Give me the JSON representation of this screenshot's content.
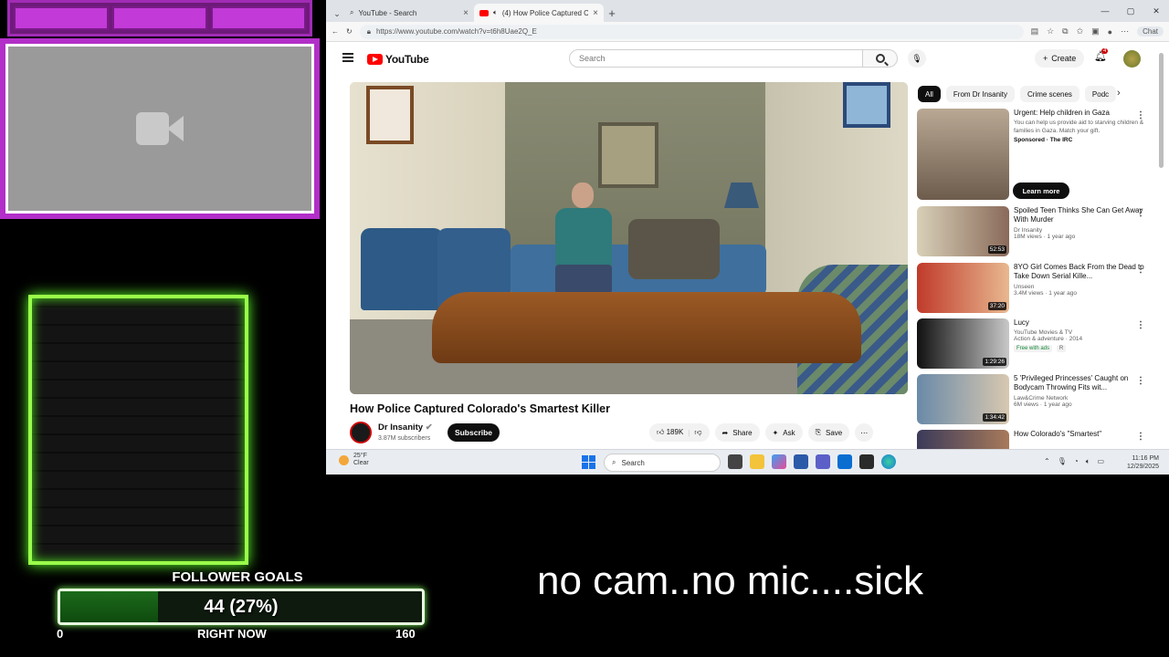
{
  "overlay": {
    "follower_goals_title": "FOLLOWER GOALS",
    "goal_current": 44,
    "goal_percent": 0.27,
    "goal_text": "44 (27%)",
    "goal_min": "0",
    "goal_now_label": "RIGHT NOW",
    "goal_max": "160",
    "caption": "no cam..no mic....sick",
    "colors": {
      "cam_frame": "#b22fc9",
      "brick_glow": "#9aff4a",
      "goal_fill": "#1c6a1c"
    }
  },
  "browser": {
    "tabs": [
      {
        "title": "YouTube - Search",
        "active": false
      },
      {
        "title": "(4) How Police Captured Colora",
        "active": true
      }
    ],
    "url": "https://www.youtube.com/watch?v=t6h8Uae2Q_E",
    "chat_label": "Chat"
  },
  "youtube": {
    "logo_text": "YouTube",
    "search_placeholder": "Search",
    "create_label": "Create",
    "notification_count": "4",
    "video": {
      "title": "How Police Captured Colorado's Smartest Killer",
      "channel": "Dr Insanity",
      "subscribers": "3.87M subscribers",
      "subscribe_label": "Subscribe",
      "likes": "189K",
      "share_label": "Share",
      "ask_label": "Ask",
      "save_label": "Save"
    },
    "chips": [
      "All",
      "From Dr Insanity",
      "Crime scenes",
      "Podc"
    ],
    "recommendations": [
      {
        "title": "Urgent: Help children in Gaza",
        "desc": "You can help us provide aid to starving children & families in Gaza. Match your gift.",
        "channel": "Sponsored · The IRC",
        "meta": "",
        "duration": "",
        "cta": "Learn more"
      },
      {
        "title": "Spoiled Teen Thinks She Can Get Away With Murder",
        "channel": "Dr Insanity",
        "meta": "18M views · 1 year ago",
        "duration": "52:53"
      },
      {
        "title": "8YO Girl Comes Back From the Dead to Take Down Serial Kille...",
        "channel": "Unseen",
        "meta": "3.4M views · 1 year ago",
        "duration": "37:20"
      },
      {
        "title": "Lucy",
        "channel": "YouTube Movies & TV",
        "meta": "Action & adventure · 2014",
        "duration": "1:29:26",
        "tags": [
          "Free with ads",
          "R"
        ]
      },
      {
        "title": "5 'Privileged Princesses' Caught on Bodycam Throwing Fits wit...",
        "channel": "Law&Crime Network",
        "meta": "6M views · 1 year ago",
        "duration": "1:34:42"
      },
      {
        "title": "How Colorado's \"Smartest\"",
        "channel": "",
        "meta": "",
        "duration": ""
      }
    ]
  },
  "taskbar": {
    "weather_temp": "25°F",
    "weather_cond": "Clear",
    "search_placeholder": "Search",
    "time": "11:16 PM",
    "date": "12/29/2025"
  }
}
